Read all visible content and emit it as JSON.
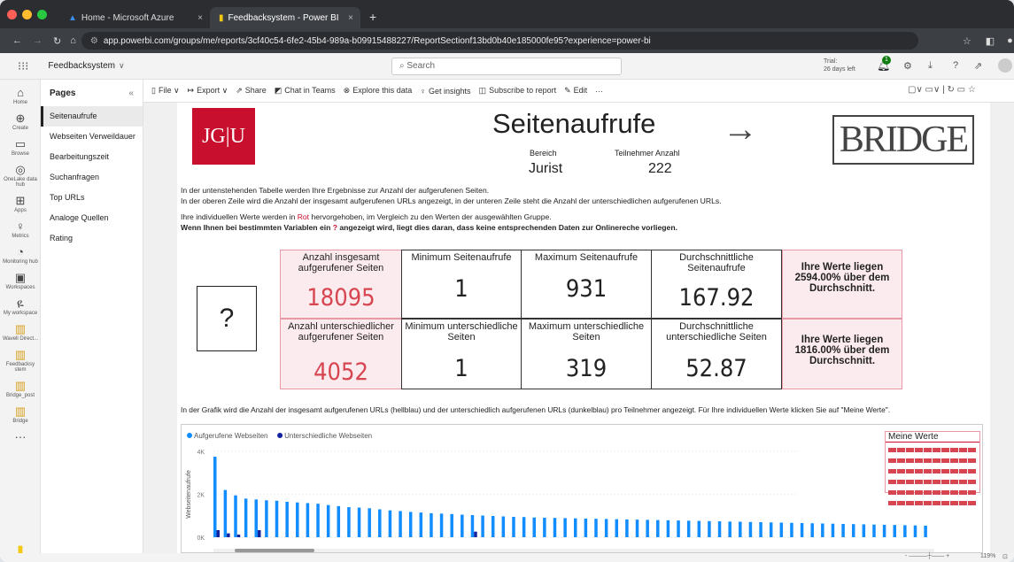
{
  "browser": {
    "tabs": [
      {
        "label": "Home - Microsoft Azure",
        "active": false
      },
      {
        "label": "Feedbacksystem - Power BI",
        "active": true
      }
    ],
    "new_tab": "+",
    "url": "app.powerbi.com/groups/me/reports/3cf40c54-6fe2-45b4-989a-b09915488227/ReportSectionf13bd0b40e185000fe95?experience=power-bi"
  },
  "header": {
    "workspace": "Feedbacksystem",
    "search_placeholder": "Search",
    "trial_label": "Trial:",
    "trial_days": "26 days left",
    "notif_count": "1"
  },
  "rail": [
    {
      "icon": "⌂",
      "label": "Home"
    },
    {
      "icon": "⊕",
      "label": "Create"
    },
    {
      "icon": "▭",
      "label": "Browse"
    },
    {
      "icon": "◎",
      "label": "OneLake data hub"
    },
    {
      "icon": "⊞",
      "label": "Apps"
    },
    {
      "icon": "♀",
      "label": "Metrics"
    },
    {
      "icon": "◔",
      "label": "Monitoring hub"
    },
    {
      "icon": "▣",
      "label": "Workspaces"
    },
    {
      "icon": "ዬ",
      "label": "My workspace"
    },
    {
      "icon": "▥",
      "label": "Wavell Direct..."
    },
    {
      "icon": "▥",
      "label": "Feedbacksy stem"
    },
    {
      "icon": "▥",
      "label": "Bridge_post"
    },
    {
      "icon": "▥",
      "label": "Bridge"
    },
    {
      "icon": "···",
      "label": ""
    }
  ],
  "rail_brand": "Power BI",
  "pages": {
    "title": "Pages",
    "collapse": "«",
    "items": [
      "Seitenaufrufe",
      "Webseiten Verweildauer",
      "Bearbeitungszeit",
      "Suchanfragen",
      "Top URLs",
      "Analoge Quellen",
      "Rating"
    ],
    "selected": 0
  },
  "toolbar": [
    "File ∨",
    "Export ∨",
    "Share",
    "Chat in Teams",
    "Explore this data",
    "Get insights",
    "Subscribe to report",
    "Edit",
    "···"
  ],
  "report": {
    "logo_text": "JG|U",
    "title": "Seitenaufrufe",
    "arrow": "→",
    "bridge_logo": "BRIDGE",
    "bereich_label": "Bereich",
    "bereich_value": "Jurist",
    "teilnehmer_label": "Teilnehmer Anzahl",
    "teilnehmer_value": "222",
    "intro1": "In der untenstehenden Tabelle werden Ihre Ergebnisse zur Anzahl der aufgerufenen Seiten.",
    "intro2": "In der oberen Zeile wird die Anzahl der insgesamt aufgerufenen URLs angezeigt, in der unteren Zeile steht die Anzahl der unterschiedlichen aufgerufenen URLs.",
    "intro3_pre": "Ihre individuellen Werte werden in ",
    "intro3_red": "Rot",
    "intro3_post": " hervorgehoben, im Vergleich zu den Werten der ausgewählten Gruppe.",
    "intro4_pre": "Wenn Ihnen bei bestimmten Variablen ein ",
    "intro4_q": "?",
    "intro4_post": " angezeigt wird, liegt dies daran, dass keine entsprechenden Daten zur Onlinereche vorliegen.",
    "qmark": "?",
    "row1": {
      "own_label": "Anzahl insgesamt aufgerufener Seiten",
      "own_value": "18095",
      "min_label": "Minimum Seitenaufrufe",
      "min_value": "1",
      "max_label": "Maximum Seitenaufrufe",
      "max_value": "931",
      "avg_label": "Durchschnittliche Seitenaufrufe",
      "avg_value": "167.92",
      "note": "Ihre Werte liegen 2594.00% über dem Durchschnitt."
    },
    "row2": {
      "own_label": "Anzahl unterschiedlicher aufgerufener Seiten",
      "own_value": "4052",
      "min_label": "Minimum unterschiedliche Seiten",
      "min_value": "1",
      "max_label": "Maximum unterschiedliche Seiten",
      "max_value": "319",
      "avg_label": "Durchschnittliche unterschiedliche Seiten",
      "avg_value": "52.87",
      "note": "Ihre Werte liegen 1816.00% über dem Durchschnitt."
    },
    "chart_intro": "In der Grafik wird die Anzahl der insgesamt aufgerufenen URLs (hellblau) und der unterschiedlich aufgerufenen URLs (dunkelblau) pro Teilnehmer angezeigt. Für Ihre individuellen Werte klicken Sie auf \"Meine Werte\".",
    "meine_werte": "Meine Werte"
  },
  "zoom": "119%",
  "colors": {
    "accent_red": "#c8102e",
    "light_blue": "#118dff",
    "dark_blue": "#12239e",
    "cell_red_bg": "#fcebee"
  },
  "chart_data": {
    "type": "bar",
    "ylabel": "Webseitenaufrufe",
    "yticks": [
      "0K",
      "2K",
      "4K"
    ],
    "ylim": [
      0,
      4000
    ],
    "legend_position": "top-left",
    "series": [
      {
        "name": "Aufgerufene Webseiten",
        "color": "#118dff",
        "values": [
          3750,
          2200,
          1950,
          1800,
          1760,
          1720,
          1700,
          1650,
          1620,
          1590,
          1560,
          1500,
          1450,
          1400,
          1380,
          1350,
          1300,
          1250,
          1220,
          1180,
          1150,
          1120,
          1100,
          1080,
          1050,
          1030,
          1010,
          990,
          970,
          950,
          940,
          920,
          910,
          900,
          890,
          880,
          870,
          860,
          850,
          840,
          830,
          820,
          810,
          800,
          790,
          780,
          770,
          760,
          750,
          740,
          730,
          720,
          710,
          700,
          690,
          680,
          670,
          660,
          650,
          640,
          630,
          620,
          610,
          600,
          590,
          580,
          570,
          560,
          550,
          540
        ]
      },
      {
        "name": "Unterschiedliche Webseiten",
        "color": "#12239e",
        "values": [
          330,
          180,
          120,
          0,
          330,
          0,
          0,
          0,
          0,
          0,
          0,
          0,
          0,
          0,
          0,
          0,
          0,
          0,
          0,
          0,
          0,
          0,
          0,
          0,
          0,
          260,
          0,
          0,
          0,
          0,
          0,
          0,
          0,
          0,
          0,
          0,
          0,
          0,
          0,
          0,
          0,
          0,
          0,
          0,
          0,
          0,
          0,
          0,
          0,
          0,
          0,
          0,
          0,
          0,
          0,
          0,
          0,
          0,
          0,
          0,
          0,
          0,
          0,
          0,
          0,
          0,
          0,
          0,
          0,
          0
        ]
      }
    ]
  }
}
